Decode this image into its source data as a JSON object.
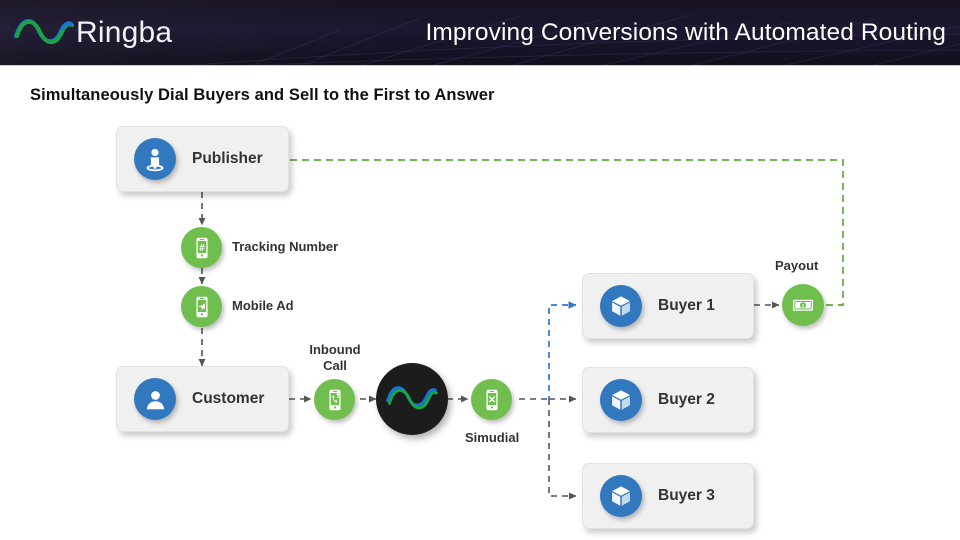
{
  "header": {
    "brand": "Ringba",
    "logo_icon": "ringba-wave-logo",
    "title": "Improving Conversions with Automated Routing",
    "background_color": "#1a1428",
    "title_color": "#ffffff"
  },
  "slide": {
    "subtitle": "Simultaneously Dial Buyers and Sell to the First to Answer",
    "background_color": "#ffffff"
  },
  "palette": {
    "blue": "#3178be",
    "green": "#6fbe4e",
    "dark": "#1c1c1c",
    "card_bg": "#f0f0f0",
    "edge_gray": "#555555",
    "edge_blue": "#2f76d4",
    "edge_green": "#5caa3e"
  },
  "diagram": {
    "cards": [
      {
        "id": "publisher",
        "label": "Publisher",
        "icon": "publisher-person-icon",
        "icon_color": "#3178be"
      },
      {
        "id": "customer",
        "label": "Customer",
        "icon": "customer-person-icon",
        "icon_color": "#3178be"
      },
      {
        "id": "buyer1",
        "label": "Buyer 1",
        "icon": "package-box-icon",
        "icon_color": "#3178be"
      },
      {
        "id": "buyer2",
        "label": "Buyer 2",
        "icon": "package-box-icon",
        "icon_color": "#3178be"
      },
      {
        "id": "buyer3",
        "label": "Buyer 3",
        "icon": "package-box-icon",
        "icon_color": "#3178be"
      }
    ],
    "nodes": [
      {
        "id": "tracking_number",
        "label": "Tracking Number",
        "icon": "phone-hash-icon",
        "icon_color": "#6fbe4e"
      },
      {
        "id": "mobile_ad",
        "label": "Mobile Ad",
        "icon": "phone-megaphone-icon",
        "icon_color": "#6fbe4e"
      },
      {
        "id": "inbound_call",
        "label": "Inbound\nCall",
        "label_line1": "Inbound",
        "label_line2": "Call",
        "icon": "phone-incoming-call-icon",
        "icon_color": "#6fbe4e"
      },
      {
        "id": "ringba_hub",
        "label": "",
        "icon": "ringba-wave-logo",
        "icon_color": "#1c1c1c"
      },
      {
        "id": "simudial",
        "label": "Simudial",
        "icon": "phone-simudial-icon",
        "icon_color": "#6fbe4e"
      },
      {
        "id": "payout",
        "label": "Payout",
        "icon": "dollar-bill-icon",
        "icon_color": "#6fbe4e"
      }
    ],
    "flows": [
      {
        "from": "publisher",
        "to": "tracking_number",
        "style": "dashed-gray",
        "direction": "down"
      },
      {
        "from": "tracking_number",
        "to": "mobile_ad",
        "style": "dashed-gray",
        "direction": "down"
      },
      {
        "from": "mobile_ad",
        "to": "customer",
        "style": "dashed-gray",
        "direction": "down"
      },
      {
        "from": "customer",
        "to": "inbound_call",
        "style": "dashed-gray",
        "direction": "right"
      },
      {
        "from": "inbound_call",
        "to": "ringba_hub",
        "style": "dashed-gray",
        "direction": "right"
      },
      {
        "from": "ringba_hub",
        "to": "simudial",
        "style": "dashed-gray",
        "direction": "right"
      },
      {
        "from": "simudial",
        "to": "buyer2",
        "style": "dashed-gray",
        "direction": "right"
      },
      {
        "from": "simudial",
        "to": "buyer1",
        "style": "dashed-blue",
        "direction": "up-right"
      },
      {
        "from": "simudial",
        "to": "buyer3",
        "style": "dashed-gray",
        "direction": "down-right"
      },
      {
        "from": "buyer1",
        "to": "payout",
        "style": "dashed-gray",
        "direction": "right"
      },
      {
        "from": "payout",
        "to": "publisher",
        "style": "dashed-green",
        "direction": "return-loop"
      }
    ]
  }
}
